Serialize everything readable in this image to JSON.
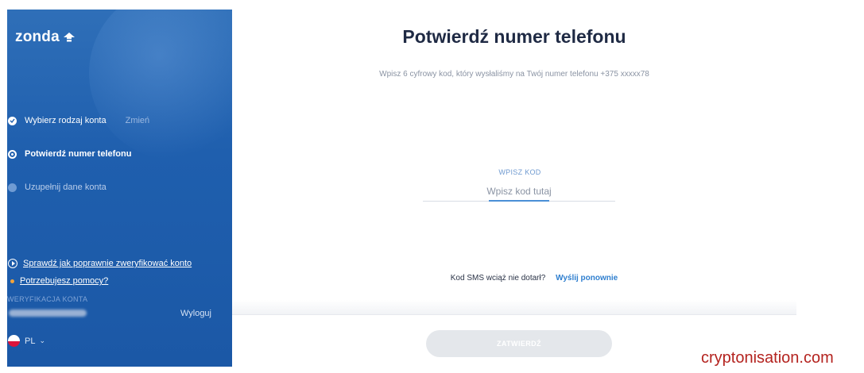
{
  "brand": {
    "name": "zonda",
    "accent": "#1f5fae"
  },
  "sidebar": {
    "steps": [
      {
        "label": "Wybierz rodzaj konta",
        "action": "Zmień",
        "state": "done"
      },
      {
        "label": "Potwierdź numer telefonu",
        "state": "active"
      },
      {
        "label": "Uzupełnij dane konta",
        "state": "pending"
      }
    ],
    "help": {
      "verify_link": "Sprawdź jak poprawnie zweryfikować konto",
      "help_link": "Potrzebujesz pomocy?"
    },
    "section_label": "WERYFIKACJA KONTA",
    "logout": "Wyloguj",
    "language": "PL"
  },
  "main": {
    "title": "Potwierdź numer telefonu",
    "subtitle": "Wpisz 6 cyfrowy kod, który wysłaliśmy na Twój numer telefonu +375 xxxxx78",
    "code_label": "WPISZ KOD",
    "code_placeholder": "Wpisz kod tutaj",
    "sms_question": "Kod SMS wciąż nie dotarł?",
    "resend_label": "Wyślij ponownie",
    "submit_label": "ZATWIERDŹ"
  },
  "watermark": "cryptonisation.com"
}
